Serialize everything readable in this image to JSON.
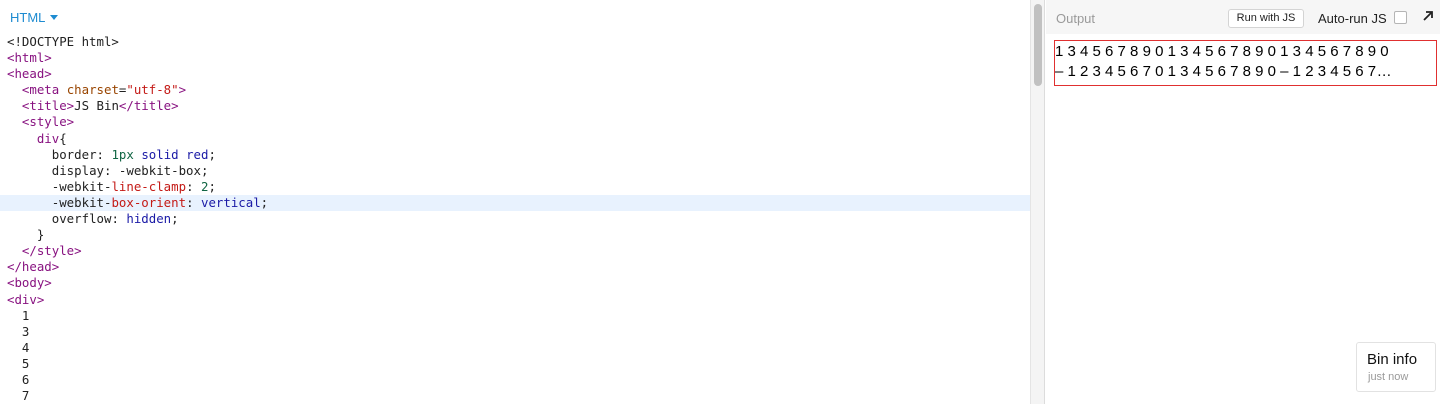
{
  "editor": {
    "language_label": "HTML",
    "active_line": 11,
    "lines": [
      [
        {
          "t": "punc",
          "v": "<!DOCTYPE html>"
        }
      ],
      [
        {
          "t": "tag",
          "v": "<html>"
        }
      ],
      [
        {
          "t": "tag",
          "v": "<head>"
        }
      ],
      [
        {
          "t": "text",
          "v": "  "
        },
        {
          "t": "tag",
          "v": "<meta "
        },
        {
          "t": "attr",
          "v": "charset"
        },
        {
          "t": "punc",
          "v": "="
        },
        {
          "t": "str",
          "v": "\"utf-8\""
        },
        {
          "t": "tag",
          "v": ">"
        }
      ],
      [
        {
          "t": "text",
          "v": "  "
        },
        {
          "t": "tag",
          "v": "<title>"
        },
        {
          "t": "text",
          "v": "JS Bin"
        },
        {
          "t": "tag",
          "v": "</title>"
        }
      ],
      [
        {
          "t": "text",
          "v": "  "
        },
        {
          "t": "tag",
          "v": "<style>"
        }
      ],
      [
        {
          "t": "text",
          "v": "    "
        },
        {
          "t": "tag",
          "v": "div"
        },
        {
          "t": "punc",
          "v": "{"
        }
      ],
      [
        {
          "t": "text",
          "v": "      "
        },
        {
          "t": "prop",
          "v": "border"
        },
        {
          "t": "punc",
          "v": ": "
        },
        {
          "t": "num",
          "v": "1px"
        },
        {
          "t": "punc",
          "v": " "
        },
        {
          "t": "val",
          "v": "solid"
        },
        {
          "t": "punc",
          "v": " "
        },
        {
          "t": "val",
          "v": "red"
        },
        {
          "t": "punc",
          "v": ";"
        }
      ],
      [
        {
          "t": "text",
          "v": "      "
        },
        {
          "t": "prop",
          "v": "display"
        },
        {
          "t": "punc",
          "v": ": "
        },
        {
          "t": "prop",
          "v": "-webkit-box"
        },
        {
          "t": "punc",
          "v": ";"
        }
      ],
      [
        {
          "t": "text",
          "v": "      "
        },
        {
          "t": "prop",
          "v": "-webkit-"
        },
        {
          "t": "propred",
          "v": "line-clamp"
        },
        {
          "t": "punc",
          "v": ": "
        },
        {
          "t": "num",
          "v": "2"
        },
        {
          "t": "punc",
          "v": ";"
        }
      ],
      [
        {
          "t": "text",
          "v": "      "
        },
        {
          "t": "prop",
          "v": "-webkit-"
        },
        {
          "t": "propred",
          "v": "box-orient"
        },
        {
          "t": "punc",
          "v": ": "
        },
        {
          "t": "val",
          "v": "vertical"
        },
        {
          "t": "punc",
          "v": ";"
        }
      ],
      [
        {
          "t": "text",
          "v": "      "
        },
        {
          "t": "prop",
          "v": "overflow"
        },
        {
          "t": "punc",
          "v": ": "
        },
        {
          "t": "val",
          "v": "hidden"
        },
        {
          "t": "punc",
          "v": ";"
        }
      ],
      [
        {
          "t": "text",
          "v": "    "
        },
        {
          "t": "punc",
          "v": "}"
        }
      ],
      [
        {
          "t": "text",
          "v": "  "
        },
        {
          "t": "tag",
          "v": "</style>"
        }
      ],
      [
        {
          "t": "tag",
          "v": "</head>"
        }
      ],
      [
        {
          "t": "tag",
          "v": "<body>"
        }
      ],
      [
        {
          "t": "tag",
          "v": "<div>"
        }
      ],
      [
        {
          "t": "text",
          "v": "  1"
        }
      ],
      [
        {
          "t": "text",
          "v": "  3"
        }
      ],
      [
        {
          "t": "text",
          "v": "  4"
        }
      ],
      [
        {
          "t": "text",
          "v": "  5"
        }
      ],
      [
        {
          "t": "text",
          "v": "  6"
        }
      ],
      [
        {
          "t": "text",
          "v": "  7"
        }
      ]
    ]
  },
  "output": {
    "title": "Output",
    "run_js_label": "Run with JS",
    "autorun_label": "Auto-run JS",
    "autorun_checked": false,
    "popout_icon": "popout-arrow-icon",
    "clamped_lines": [
      "1 3 4 5 6 7 8 9 0 1 3 4 5 6 7 8 9 0 1 3 4 5 6 7 8 9 0",
      "– 1 2 3 4 5 6 7 0 1 3 4 5 6 7 8 9 0 – 1 2 3 4 5 6 7…"
    ],
    "clamp_border_color": "#e03030",
    "bin_info": {
      "title": "Bin info",
      "time": "just now"
    }
  },
  "colors": {
    "accent": "#1d8bd1",
    "active_line_bg": "#e8f2fe",
    "tag": "#881280",
    "attribute": "#994500",
    "string": "#c41a16"
  }
}
